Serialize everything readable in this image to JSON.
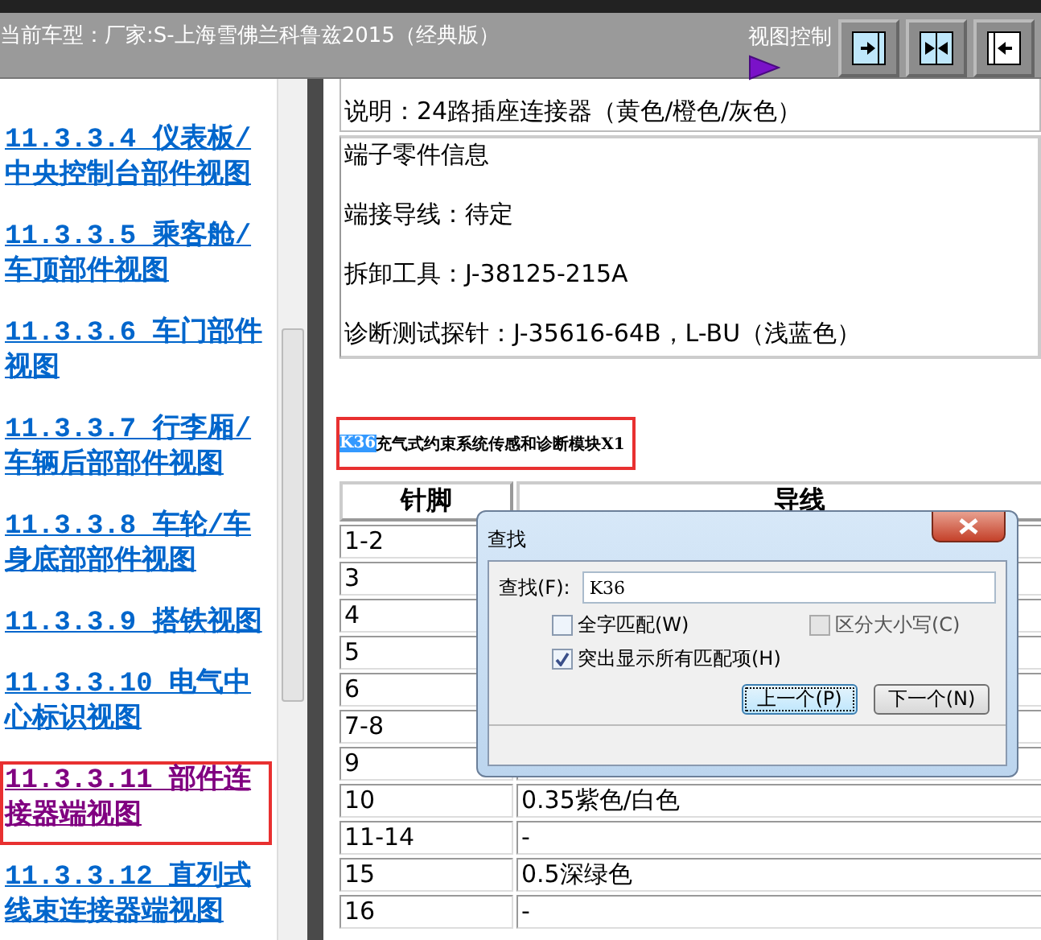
{
  "header": {
    "title": "当前车型：厂家:S-上海雪佛兰科鲁兹2015（经典版）",
    "view_control": {
      "label": "视图控制",
      "buttons": [
        {
          "kind": "expand-right"
        },
        {
          "kind": "split"
        },
        {
          "kind": "collapse-left"
        }
      ]
    }
  },
  "sidebar": {
    "items": [
      {
        "label": "11.3.3.4 仪表板/中央控制台部件视图",
        "selected": false,
        "framed": false
      },
      {
        "label": "11.3.3.5 乘客舱/车顶部件视图",
        "selected": false,
        "framed": false
      },
      {
        "label": "11.3.3.6 车门部件视图",
        "selected": false,
        "framed": false
      },
      {
        "label": "11.3.3.7 行李厢/车辆后部部件视图",
        "selected": false,
        "framed": false
      },
      {
        "label": "11.3.3.8 车轮/车身底部部件视图",
        "selected": false,
        "framed": false
      },
      {
        "label": "11.3.3.9 搭铁视图",
        "selected": false,
        "framed": false
      },
      {
        "label": "11.3.3.10 电气中心标识视图",
        "selected": false,
        "framed": false
      },
      {
        "label": "11.3.3.11 部件连接器端视图",
        "selected": true,
        "framed": true
      },
      {
        "label": "11.3.3.12 直列式线束连接器端视图",
        "selected": false,
        "framed": false
      }
    ]
  },
  "content": {
    "description": "说明：24路插座连接器（黄色/橙色/灰色）",
    "terminal_info": [
      "端子零件信息",
      "端接导线：待定",
      "拆卸工具：J-38125-215A",
      "诊断测试探针：J-35616-64B，L-BU（浅蓝色）"
    ],
    "heading": {
      "match": "K36",
      "rest": "充气式约束系统传感和诊断模块X1",
      "framed": true
    },
    "table": {
      "columns": [
        "针脚",
        "导线"
      ],
      "rows": [
        {
          "pin": "1-2"
        },
        {
          "pin": "3"
        },
        {
          "pin": "4"
        },
        {
          "pin": "5"
        },
        {
          "pin": "6"
        },
        {
          "pin": "7-8"
        },
        {
          "pin": "9"
        },
        {
          "pin": "10",
          "wire": "0.35紫色/白色"
        },
        {
          "pin": "11-14",
          "wire": "-"
        },
        {
          "pin": "15",
          "wire": "0.5深绿色"
        },
        {
          "pin": "16",
          "wire": "-"
        }
      ]
    }
  },
  "find_dialog": {
    "title": "查找",
    "field_label": "查找(F):",
    "value": "K36",
    "options": [
      {
        "label": "全字匹配(W)",
        "checked": false,
        "disabled": false
      },
      {
        "label": "区分大小写(C)",
        "checked": false,
        "disabled": true
      },
      {
        "label": "突出显示所有匹配项(H)",
        "checked": true,
        "disabled": false
      }
    ],
    "buttons": [
      {
        "label": "上一个(P)",
        "focused": true
      },
      {
        "label": "下一个(N)",
        "focused": false
      }
    ]
  }
}
